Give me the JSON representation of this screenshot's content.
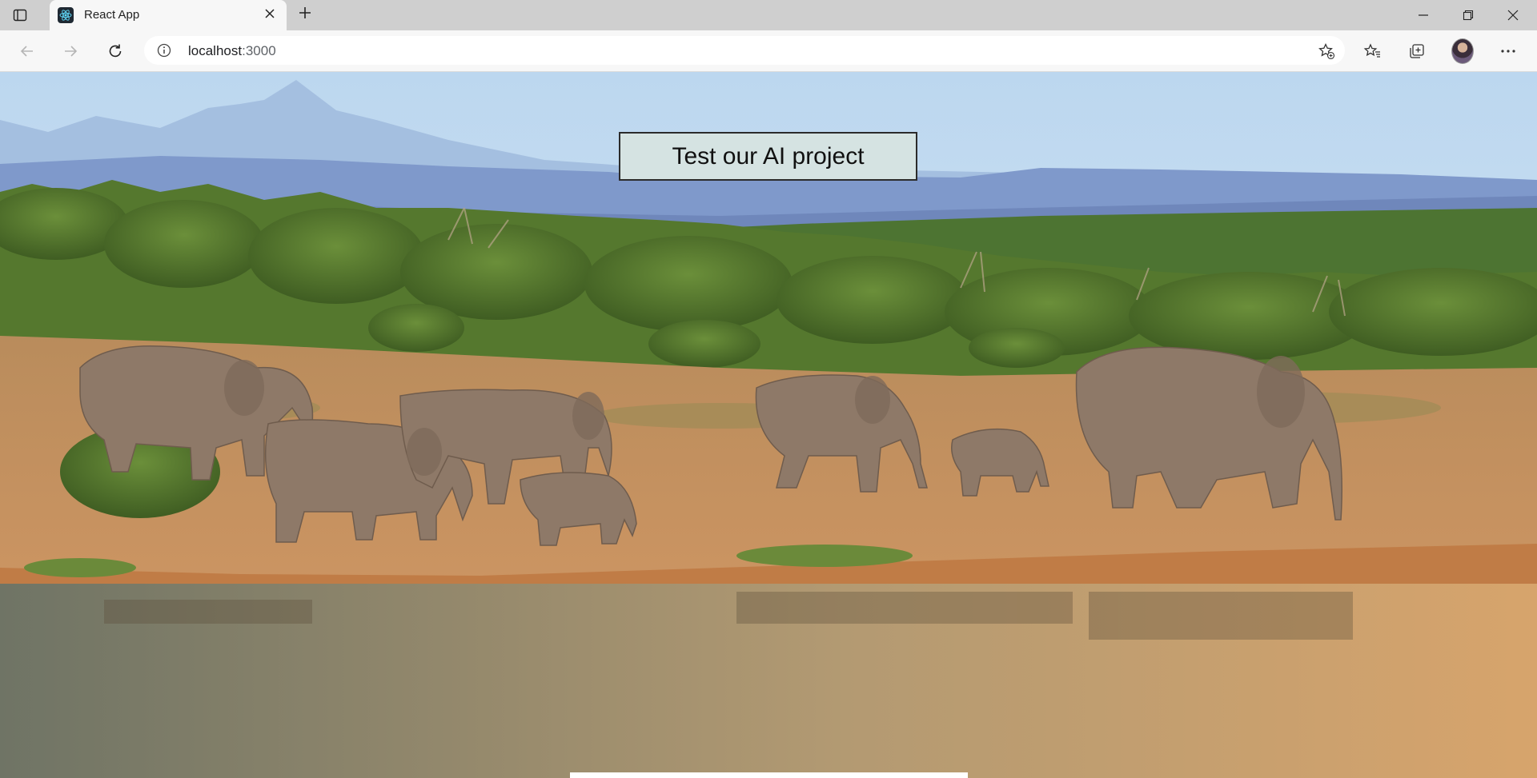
{
  "browser": {
    "tab": {
      "title": "React App"
    },
    "address_bar": {
      "url_host": "localhost",
      "url_rest": ":3000"
    }
  },
  "page": {
    "hero_image": "elephant-herd-savanna",
    "cta": {
      "label": "Test our AI project"
    }
  },
  "icons": {
    "tab_actions": "tab-actions-icon",
    "favicon": "react-logo-icon",
    "close_tab": "close-icon",
    "new_tab": "plus-icon",
    "back": "arrow-left-icon",
    "forward": "arrow-right-icon",
    "reload": "reload-icon",
    "site_info": "info-icon",
    "add_favorite": "star-plus-icon",
    "favorites": "favorites-icon",
    "collections": "collections-icon",
    "more": "more-icon"
  },
  "colors": {
    "cta_background": "#d5e3e2",
    "sky": "#cfe3f3",
    "savanna": "#c58f5c"
  }
}
